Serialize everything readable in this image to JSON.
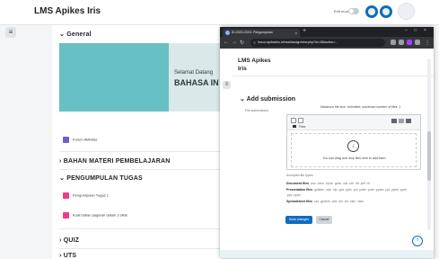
{
  "site": {
    "title": "LMS Apikes Iris",
    "edit_mode_label": "Edit mode"
  },
  "course": {
    "sections": [
      {
        "title": "General"
      },
      {
        "title": "BAHAN MATERI PEMBELAJARAN"
      },
      {
        "title": "PENGUMPULAN TUGAS"
      },
      {
        "title": "QUIZ"
      },
      {
        "title": "UTS"
      }
    ],
    "banner": {
      "line1": "Selamat Datang",
      "line2": "BAHASA IN"
    },
    "activities": {
      "general": "Forum Aktivitas",
      "tugas1": "Pengumpulan Tugas 1",
      "tugas2": "Kuat bahan pagaran dalam 3 slide"
    }
  },
  "popup": {
    "tab_title": "ID-2023-20XX: Pengumpulan",
    "url": "lms.ur.apikesiris.id/mod/assign/view.php?id=45&action=...",
    "brand": "LMS Apikes Iris",
    "heading": "Add submission",
    "field_label": "File submissions",
    "max_info": "Maximum file size: Unlimited, maximum number of files: 1",
    "files_label": "Files",
    "drop_text": "You can drag and drop files here to add them.",
    "accepted_label": "Accepted file types:",
    "file_types": [
      {
        "name": "Document files",
        "exts": ".doc .docx .epub .gdoc .odt .oth .ott .pdf .rtf"
      },
      {
        "name": "Presentation files",
        "exts": ".gslides .odp .otp .pps .pptx .pot .potm .potx .ppam .ppt .pptm .pptx"
      },
      {
        "name": "",
        "exts": ".pps .ppsx"
      },
      {
        "name": "Spreadsheet files",
        "exts": ".csv .gsheet .ods .ots .xls .xlsx .xlsm"
      }
    ],
    "save_label": "Save changes",
    "cancel_label": "Cancel",
    "help_label": "?"
  },
  "colors": {
    "primary": "#0f6cbf",
    "banner": "#67c0c4",
    "browser_dark": "#202124"
  },
  "icons": [
    "menu-icon",
    "bell-icon",
    "chat-icon",
    "user-avatar-icon",
    "download-icon",
    "folder-icon"
  ]
}
